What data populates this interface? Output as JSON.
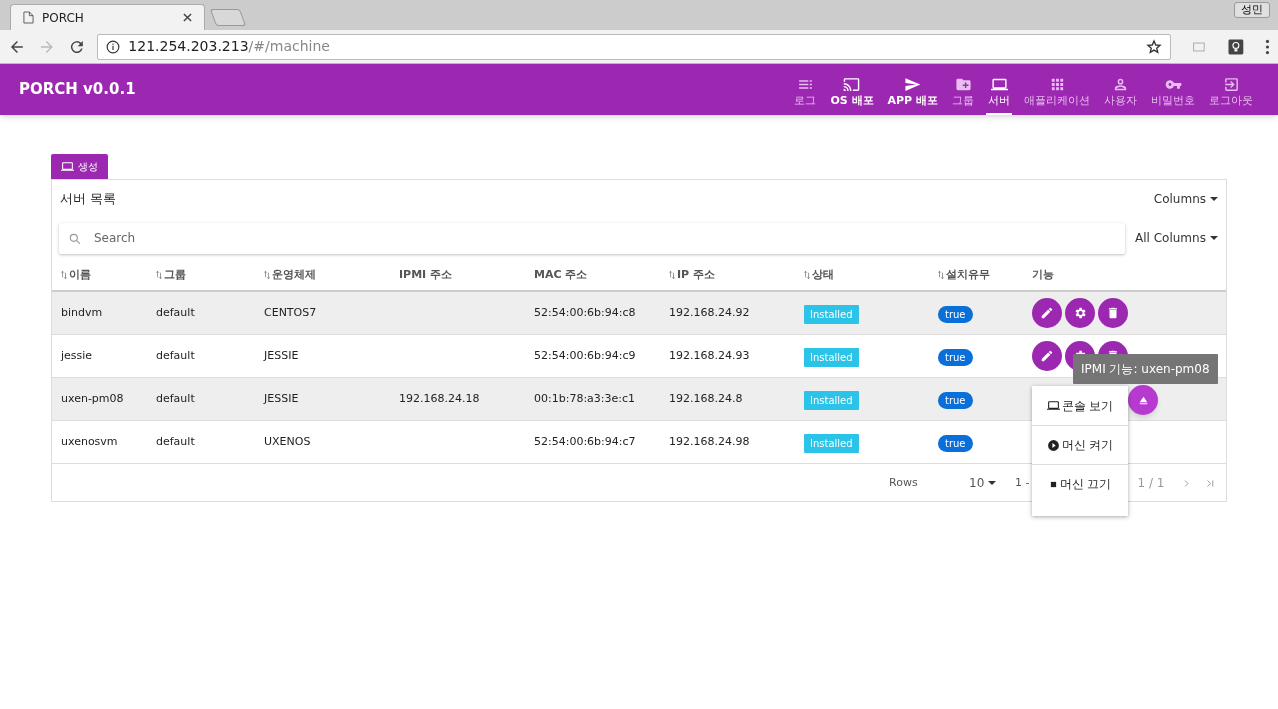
{
  "browser": {
    "tab_title": "PORCH",
    "profile": "성민",
    "url_host": "121.254.203.213",
    "url_path": "/#/machine"
  },
  "app": {
    "title": "PORCH v0.0.1"
  },
  "nav": [
    {
      "label": "로그",
      "emphasis": false,
      "selected": false
    },
    {
      "label": "OS 배포",
      "emphasis": true,
      "selected": false
    },
    {
      "label": "APP 배포",
      "emphasis": true,
      "selected": false
    },
    {
      "label": "그룹",
      "emphasis": false,
      "selected": false
    },
    {
      "label": "서버",
      "emphasis": false,
      "selected": true
    },
    {
      "label": "애플리케이션",
      "emphasis": false,
      "selected": false
    },
    {
      "label": "사용자",
      "emphasis": false,
      "selected": false
    },
    {
      "label": "비밀번호",
      "emphasis": false,
      "selected": false
    },
    {
      "label": "로그아웃",
      "emphasis": false,
      "selected": false
    }
  ],
  "create_button": "생성",
  "table": {
    "title": "서버 목록",
    "columns_menu": "Columns",
    "search_placeholder": "Search",
    "search_scope": "All Columns",
    "columns": [
      {
        "label": "이름",
        "sortable": true
      },
      {
        "label": "그룹",
        "sortable": true
      },
      {
        "label": "운영체제",
        "sortable": true
      },
      {
        "label": "IPMI 주소",
        "sortable": false
      },
      {
        "label": "MAC 주소",
        "sortable": false
      },
      {
        "label": "IP 주소",
        "sortable": true
      },
      {
        "label": "상태",
        "sortable": true
      },
      {
        "label": "설치유무",
        "sortable": true
      },
      {
        "label": "기능",
        "sortable": false
      }
    ],
    "rows": [
      {
        "name": "bindvm",
        "group": "default",
        "os": "CENTOS7",
        "ipmi": "",
        "mac": "52:54:00:6b:94:c8",
        "ip": "192.168.24.92",
        "status": "Installed",
        "installed": "true",
        "actions": [
          {
            "kind": "edit"
          },
          {
            "kind": "settings"
          },
          {
            "kind": "delete"
          }
        ]
      },
      {
        "name": "jessie",
        "group": "default",
        "os": "JESSIE",
        "ipmi": "",
        "mac": "52:54:00:6b:94:c9",
        "ip": "192.168.24.93",
        "status": "Installed",
        "installed": "true",
        "actions": [
          {
            "kind": "edit"
          },
          {
            "kind": "settings"
          },
          {
            "kind": "delete"
          }
        ]
      },
      {
        "name": "uxen-pm08",
        "group": "default",
        "os": "JESSIE",
        "ipmi": "192.168.24.18",
        "mac": "00:1b:78:a3:3e:c1",
        "ip": "192.168.24.8",
        "status": "Installed",
        "installed": "true",
        "actions": []
      },
      {
        "name": "uxenosvm",
        "group": "default",
        "os": "UXENOS",
        "ipmi": "",
        "mac": "52:54:00:6b:94:c7",
        "ip": "192.168.24.98",
        "status": "Installed",
        "installed": "true",
        "actions": []
      }
    ],
    "footer": {
      "rows_label": "Rows",
      "rows_value": "10",
      "range": "1 -",
      "pages": "1 / 1"
    }
  },
  "ipmi_popup": {
    "tooltip": "IPMI 기능: uxen-pm08",
    "menu": [
      {
        "label": "콘솔 보기"
      },
      {
        "label": "머신 켜기"
      },
      {
        "label": "머신 끄기"
      }
    ]
  }
}
